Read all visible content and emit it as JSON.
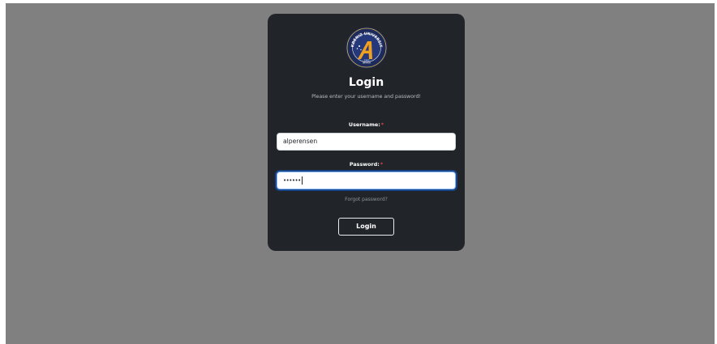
{
  "card": {
    "title": "Login",
    "subtitle": "Please enter your username and password!",
    "logo": {
      "icon": "university-logo-icon",
      "text": "AKDENIZ UNIVERSITY",
      "year": "1982",
      "city": "ANTALYA",
      "primary_color": "#1d2b5c",
      "accent_color": "#f0a020"
    }
  },
  "form": {
    "username_label": "Username:",
    "username_required": "*",
    "username_value": "alperensen",
    "password_label": "Password:",
    "password_required": "*",
    "password_mask": "••••••",
    "forgot_link": "Forgot password?",
    "submit_label": "Login"
  },
  "colors": {
    "page_background": "#808080",
    "card_background": "#212529",
    "focus_ring": "#0d6efd",
    "required_marker": "#e0424b"
  }
}
